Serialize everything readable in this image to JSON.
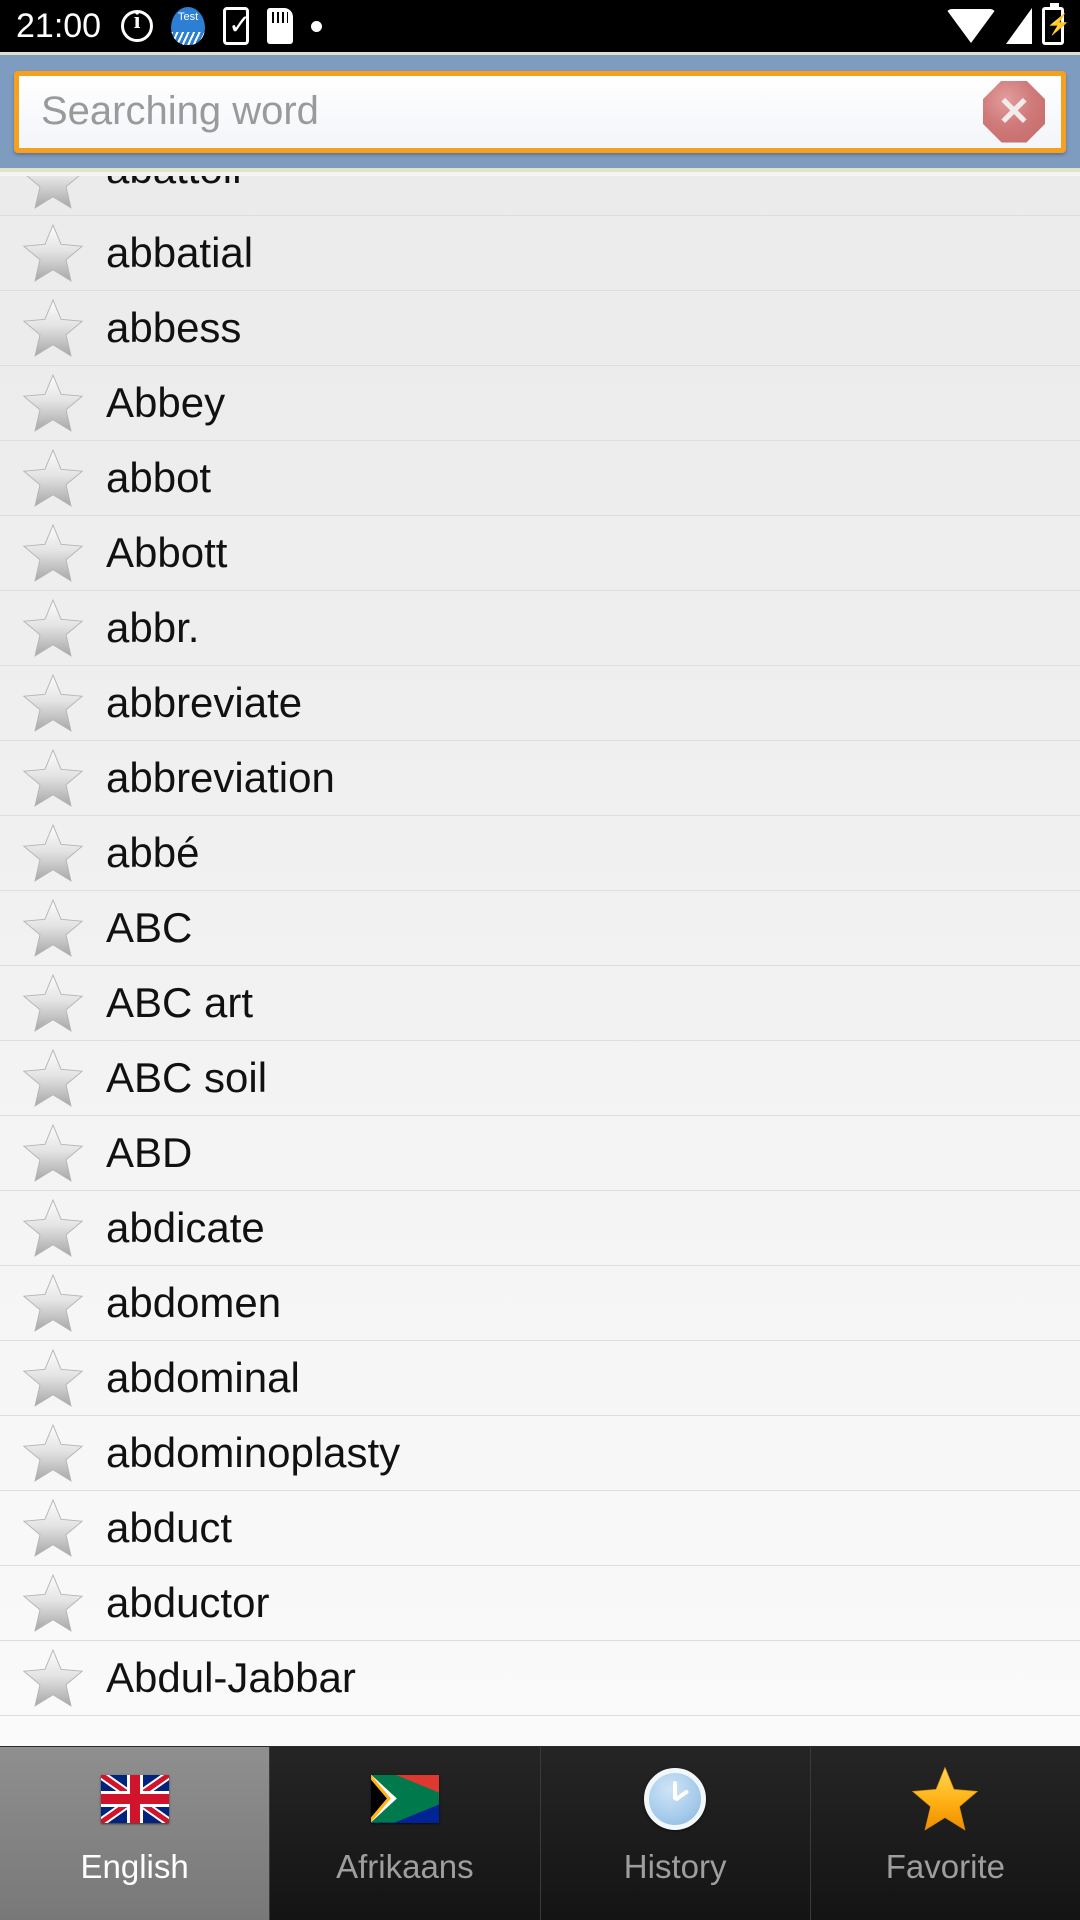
{
  "statusbar": {
    "time": "21:00",
    "left_icons": [
      "info-icon",
      "app-notification-icon",
      "phone-check-icon",
      "sd-card-icon",
      "dot-icon"
    ],
    "right_icons": [
      "wifi-icon",
      "signal-icon",
      "battery-charging-icon"
    ]
  },
  "search": {
    "placeholder": "Searching word",
    "value": "",
    "clear_label": "✕",
    "accent_border": "#f5a01f",
    "header_bg": "#7e9bc0"
  },
  "word_list": {
    "items": [
      {
        "word": "abattoir",
        "partial": true
      },
      {
        "word": "abbatial",
        "partial": false
      },
      {
        "word": "abbess",
        "partial": false
      },
      {
        "word": "Abbey",
        "partial": false
      },
      {
        "word": "abbot",
        "partial": false
      },
      {
        "word": "Abbott",
        "partial": false
      },
      {
        "word": "abbr.",
        "partial": false
      },
      {
        "word": "abbreviate",
        "partial": false
      },
      {
        "word": "abbreviation",
        "partial": false
      },
      {
        "word": "abbé",
        "partial": false
      },
      {
        "word": "ABC",
        "partial": false
      },
      {
        "word": "ABC art",
        "partial": false
      },
      {
        "word": "ABC soil",
        "partial": false
      },
      {
        "word": "ABD",
        "partial": false
      },
      {
        "word": "abdicate",
        "partial": false
      },
      {
        "word": "abdomen",
        "partial": false
      },
      {
        "word": "abdominal",
        "partial": false
      },
      {
        "word": "abdominoplasty",
        "partial": false
      },
      {
        "word": "abduct",
        "partial": false
      },
      {
        "word": "abductor",
        "partial": false
      },
      {
        "word": "Abdul-Jabbar",
        "partial": false
      }
    ]
  },
  "tabbar": {
    "tabs": [
      {
        "label": "English",
        "icon": "uk-flag-icon",
        "selected": true
      },
      {
        "label": "Afrikaans",
        "icon": "south-africa-flag-icon",
        "selected": false
      },
      {
        "label": "History",
        "icon": "clock-icon",
        "selected": false
      },
      {
        "label": "Favorite",
        "icon": "gold-star-icon",
        "selected": false
      }
    ]
  }
}
